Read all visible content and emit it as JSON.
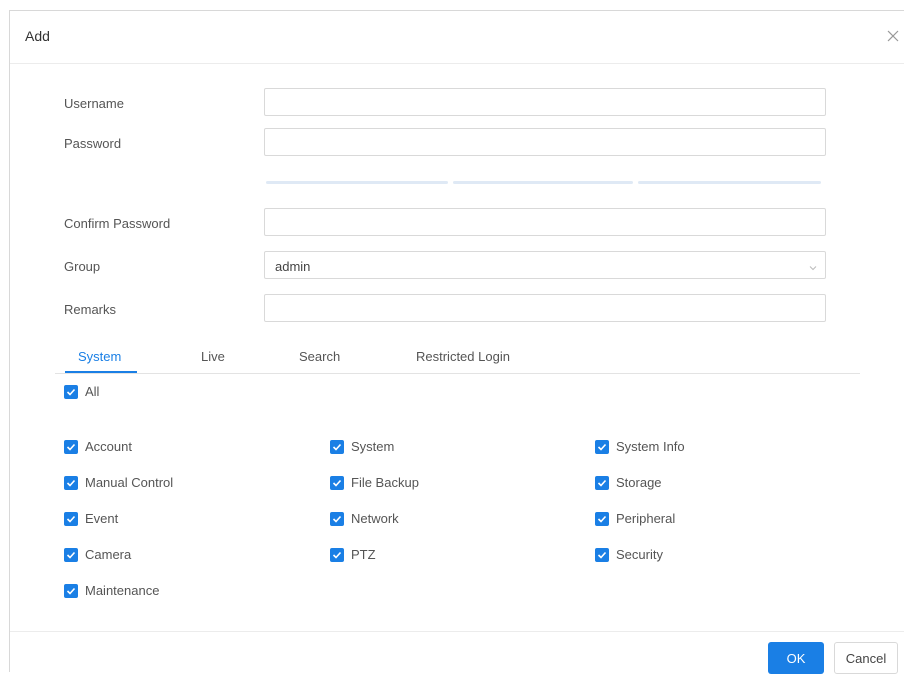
{
  "dialog": {
    "title": "Add",
    "close_icon": "close-icon"
  },
  "form": {
    "username_label": "Username",
    "username_value": "",
    "password_label": "Password",
    "password_value": "",
    "confirm_label": "Confirm Password",
    "confirm_value": "",
    "group_label": "Group",
    "group_value": "admin",
    "remarks_label": "Remarks",
    "remarks_value": ""
  },
  "tabs": [
    "System",
    "Live",
    "Search",
    "Restricted Login"
  ],
  "active_tab": "System",
  "permissions": {
    "all_label": "All",
    "items": [
      "Account",
      "System",
      "System Info",
      "Manual Control",
      "File Backup",
      "Storage",
      "Event",
      "Network",
      "Peripheral",
      "Camera",
      "PTZ",
      "Security",
      "Maintenance"
    ]
  },
  "footer": {
    "ok_label": "OK",
    "cancel_label": "Cancel"
  },
  "colors": {
    "accent": "#1a7fe5",
    "strength_bar": "#dfe9f5"
  }
}
